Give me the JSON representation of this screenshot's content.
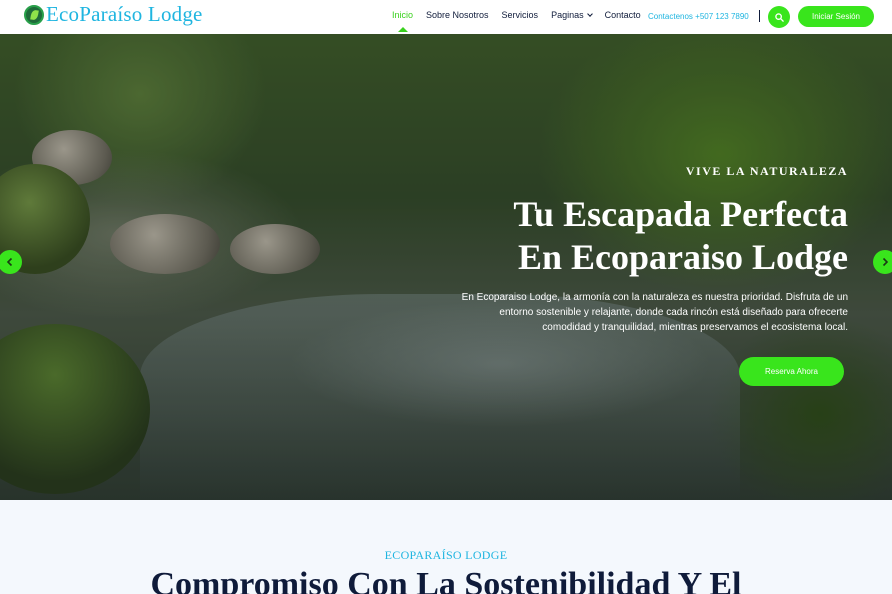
{
  "brand": {
    "name": "EcoParaíso Lodge"
  },
  "nav": {
    "items": [
      "Inicio",
      "Sobre Nosotros",
      "Servicios",
      "Paginas",
      "Contacto"
    ],
    "active": "Inicio",
    "contact": "Contactenos +507 123 7890",
    "login_label": "Iniciar Sesión"
  },
  "hero": {
    "eyebrow": "VIVE LA NATURALEZA",
    "title_line1": "Tu Escapada Perfecta",
    "title_line2": "En Ecoparaiso Lodge",
    "description": "En Ecoparaiso Lodge, la armonía con la naturaleza es nuestra prioridad. Disfruta de un entorno sostenible y relajante, donde cada rincón está diseñado para ofrecerte comodidad y tranquilidad, mientras preservamos el ecosistema local.",
    "cta_label": "Reserva Ahora"
  },
  "about": {
    "eyebrow": "ECOPARAÍSO LODGE",
    "title": "Compromiso Con La Sostenibilidad Y El"
  },
  "colors": {
    "accent": "#39e51c",
    "brand": "#1fb5e0",
    "navy": "#0f1b3a"
  },
  "icons": {
    "search": "search-icon",
    "prev": "chevron-left-icon",
    "next": "chevron-right-icon",
    "logo": "leaf-globe-icon"
  }
}
